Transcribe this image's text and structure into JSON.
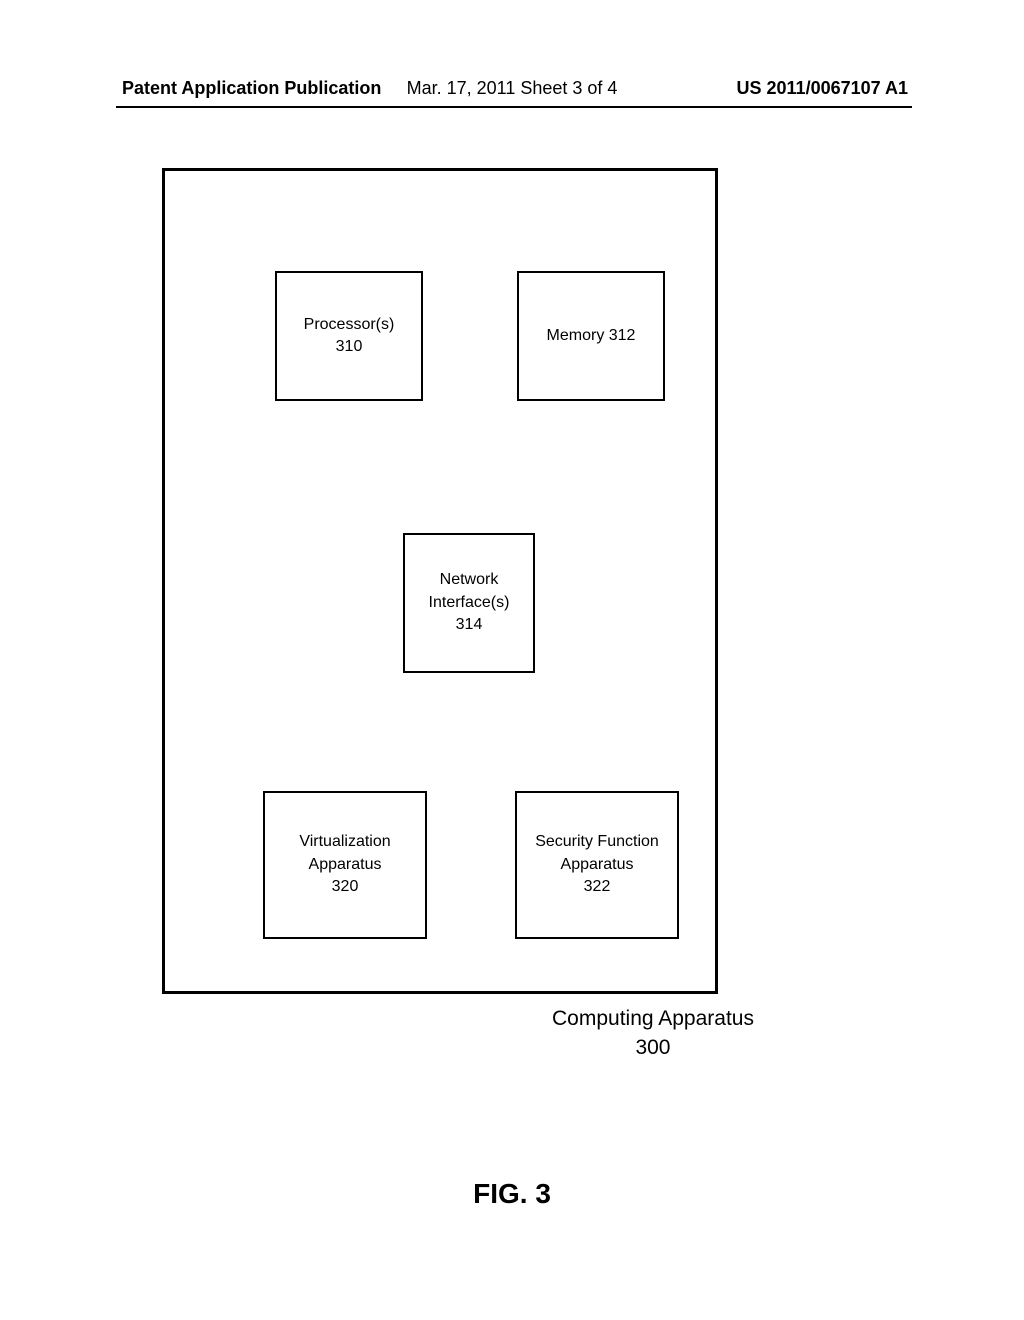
{
  "header": {
    "left": "Patent Application Publication",
    "center": "Mar. 17, 2011  Sheet 3 of 4",
    "right": "US 2011/0067107 A1"
  },
  "diagram": {
    "blocks": {
      "processor": {
        "title": "Processor(s)",
        "ref": "310"
      },
      "memory": {
        "title": "Memory 312"
      },
      "network": {
        "line1": "Network",
        "line2": "Interface(s)",
        "ref": "314"
      },
      "virtualization": {
        "line1": "Virtualization",
        "line2": "Apparatus",
        "ref": "320"
      },
      "security": {
        "line1": "Security Function",
        "line2": "Apparatus",
        "ref": "322"
      }
    },
    "outer_label": {
      "title": "Computing Apparatus",
      "ref": "300"
    }
  },
  "figure_label": "FIG. 3"
}
